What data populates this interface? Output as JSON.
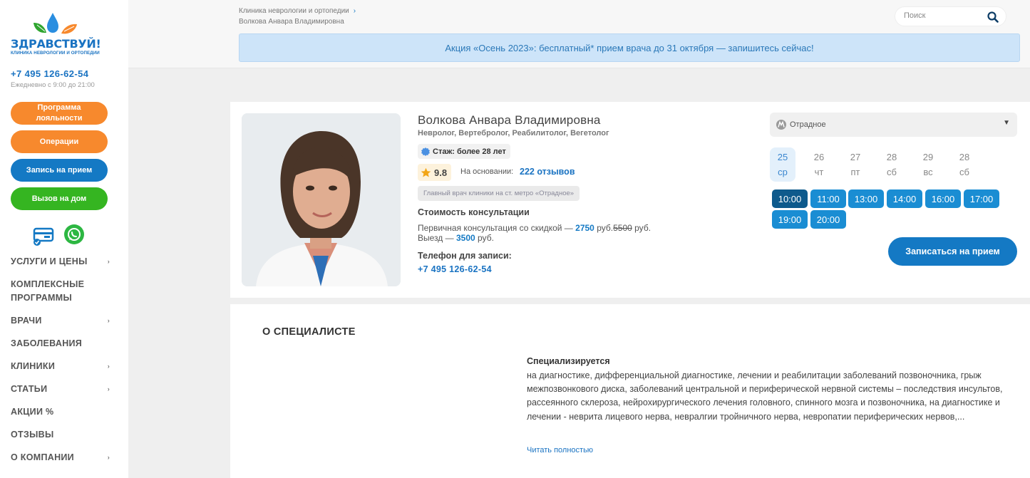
{
  "sidebar": {
    "logo_text": "ЗДРАВСТВУЙ!",
    "logo_sub": "КЛИНИКА НЕВРОЛОГИИ И ОРТОПЕДИИ",
    "phone": "+7 495 126-62-54",
    "hours": "Ежедневно с 9:00 до 21:00",
    "buttons": {
      "loyalty_line1": "Программа",
      "loyalty_line2": "лояльности",
      "operations": "Операции",
      "appointment": "Запись на прием",
      "house_call": "Вызов на дом"
    },
    "nav": [
      {
        "label": "УСЛУГИ И ЦЕНЫ",
        "arrow": "›"
      },
      {
        "label": "КОМПЛЕКСНЫЕ ПРОГРАММЫ",
        "arrow": ""
      },
      {
        "label": "ВРАЧИ",
        "arrow": "›"
      },
      {
        "label": "ЗАБОЛЕВАНИЯ",
        "arrow": ""
      },
      {
        "label": "КЛИНИКИ",
        "arrow": "›"
      },
      {
        "label": "СТАТЬИ",
        "arrow": "›"
      },
      {
        "label": "АКЦИИ %",
        "arrow": ""
      },
      {
        "label": "ОТЗЫВЫ",
        "arrow": ""
      },
      {
        "label": "О КОМПАНИИ",
        "arrow": "›"
      }
    ]
  },
  "header": {
    "breadcrumb_parent": "Клиника неврологии и ортопедии",
    "breadcrumb_arrow": "›",
    "breadcrumb_current": "Волкова Анвара Владимировна",
    "search_placeholder": "Поиск",
    "promo": "Акция «Осень 2023»: бесплатный* прием врача до 31 октября — запишитесь сейчас!"
  },
  "doctor": {
    "name": "Волкова Анвара Владимировна",
    "specialties": "Невролог, Вертебролог, Реабилитолог, Вегетолог",
    "experience": "Стаж: более 28 лет",
    "rating": "9.8",
    "basis_label": "На основании:",
    "reviews": "222 отзывов",
    "chief_badge": "Главный врач клиники на ст. метро «Отрадное»",
    "cost_title": "Стоимость консультации",
    "cost_primary_label": "Первичная консультация со скидкой —",
    "cost_primary_price": "2750",
    "cost_primary_unit": "руб.",
    "cost_primary_old": "5500",
    "cost_primary_old_unit": "руб.",
    "cost_visit_label": "Выезд —",
    "cost_visit_price": "3500",
    "cost_visit_unit": "руб.",
    "phone_title": "Телефон для записи:",
    "phone": "+7 495 126-62-54"
  },
  "booking": {
    "metro": "Отрадное",
    "caret": "▼",
    "dates": [
      {
        "day": "25",
        "weekday": "ср",
        "active": true
      },
      {
        "day": "26",
        "weekday": "чт",
        "active": false
      },
      {
        "day": "27",
        "weekday": "пт",
        "active": false
      },
      {
        "day": "28",
        "weekday": "сб",
        "active": false
      },
      {
        "day": "29",
        "weekday": "вс",
        "active": false
      },
      {
        "day": "28",
        "weekday": "сб",
        "active": false
      }
    ],
    "slots": [
      "10:00",
      "11:00",
      "13:00",
      "14:00",
      "16:00",
      "17:00",
      "19:00",
      "20:00"
    ],
    "selected_slot": "10:00",
    "book_button": "Записаться на прием"
  },
  "about": {
    "title": "О СПЕЦИАЛИСТЕ",
    "spec_title": "Специализируется",
    "spec_text": "на диагностике, дифференциальной диагностике, лечении и реабилитации заболеваний позвоночника, грыж межпозвонкового диска, заболеваний центральной и периферической нервной системы – последствия инсультов, рассеянного склероза, нейрохирургического лечения головного, спинного мозга и позвоночника, на диагностике и лечении - неврита лицевого нерва, невралгии тройничного нерва, невропатии периферических нервов,...",
    "read_more": "Читать полностью"
  },
  "colors": {
    "brand_blue": "#1479c4",
    "orange": "#f7892d",
    "green": "#35b521",
    "slot_blue": "#1a8dd3"
  }
}
